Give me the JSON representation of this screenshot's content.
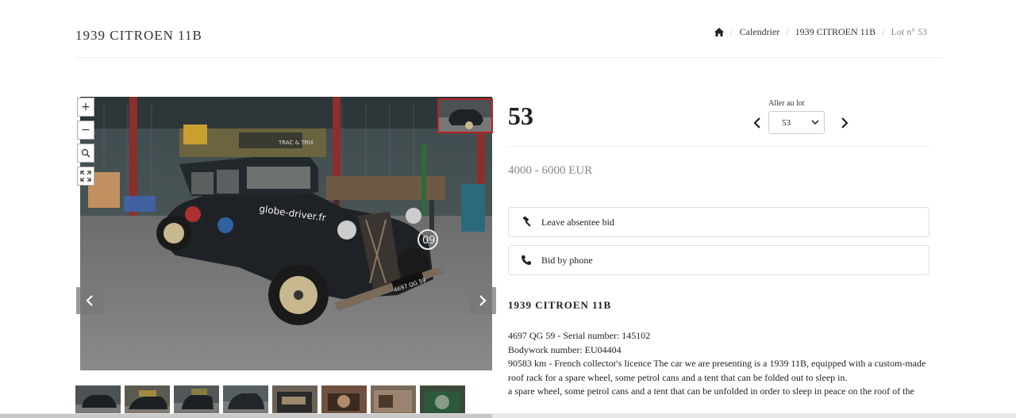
{
  "page": {
    "title": "1939 CITROEN 11B"
  },
  "breadcrumb": {
    "home_icon": "home-icon",
    "items": [
      "Calendrier",
      "1939 CITROEN 11B",
      "Lot n° 53"
    ]
  },
  "viewer": {
    "zoom_in": "+",
    "zoom_out": "−",
    "zoom_reset_icon": "magnifier-icon",
    "fullscreen_icon": "fullscreen-icon",
    "prev_icon": "chevron-left-icon",
    "next_icon": "chevron-right-icon",
    "photo_text": {
      "rack_sign": "TRAC & TRIX",
      "side_text": "globe-driver.fr",
      "plate": "4697 QG 59",
      "number": "09"
    }
  },
  "thumbnails": {
    "count": 8
  },
  "lot": {
    "number": "53",
    "goto_label": "Aller au lot",
    "goto_value": "53",
    "estimate": "4000 - 6000 EUR"
  },
  "actions": {
    "absentee_label": "Leave absentee bid",
    "absentee_icon": "gavel-icon",
    "phone_label": "Bid by phone",
    "phone_icon": "phone-icon"
  },
  "description": {
    "title": "1939 CITROEN 11B",
    "lines": [
      "4697 QG 59 - Serial number: 145102",
      "Bodywork number: EU04404",
      "90583 km - French collector's licence The car we are presenting is a 1939 11B, equipped with a custom-made roof rack for a spare wheel, some petrol cans and a tent that can be folded out to sleep in.",
      "a spare wheel, some petrol cans and a tent that can be unfolded in order to sleep in peace on the roof of the"
    ]
  }
}
